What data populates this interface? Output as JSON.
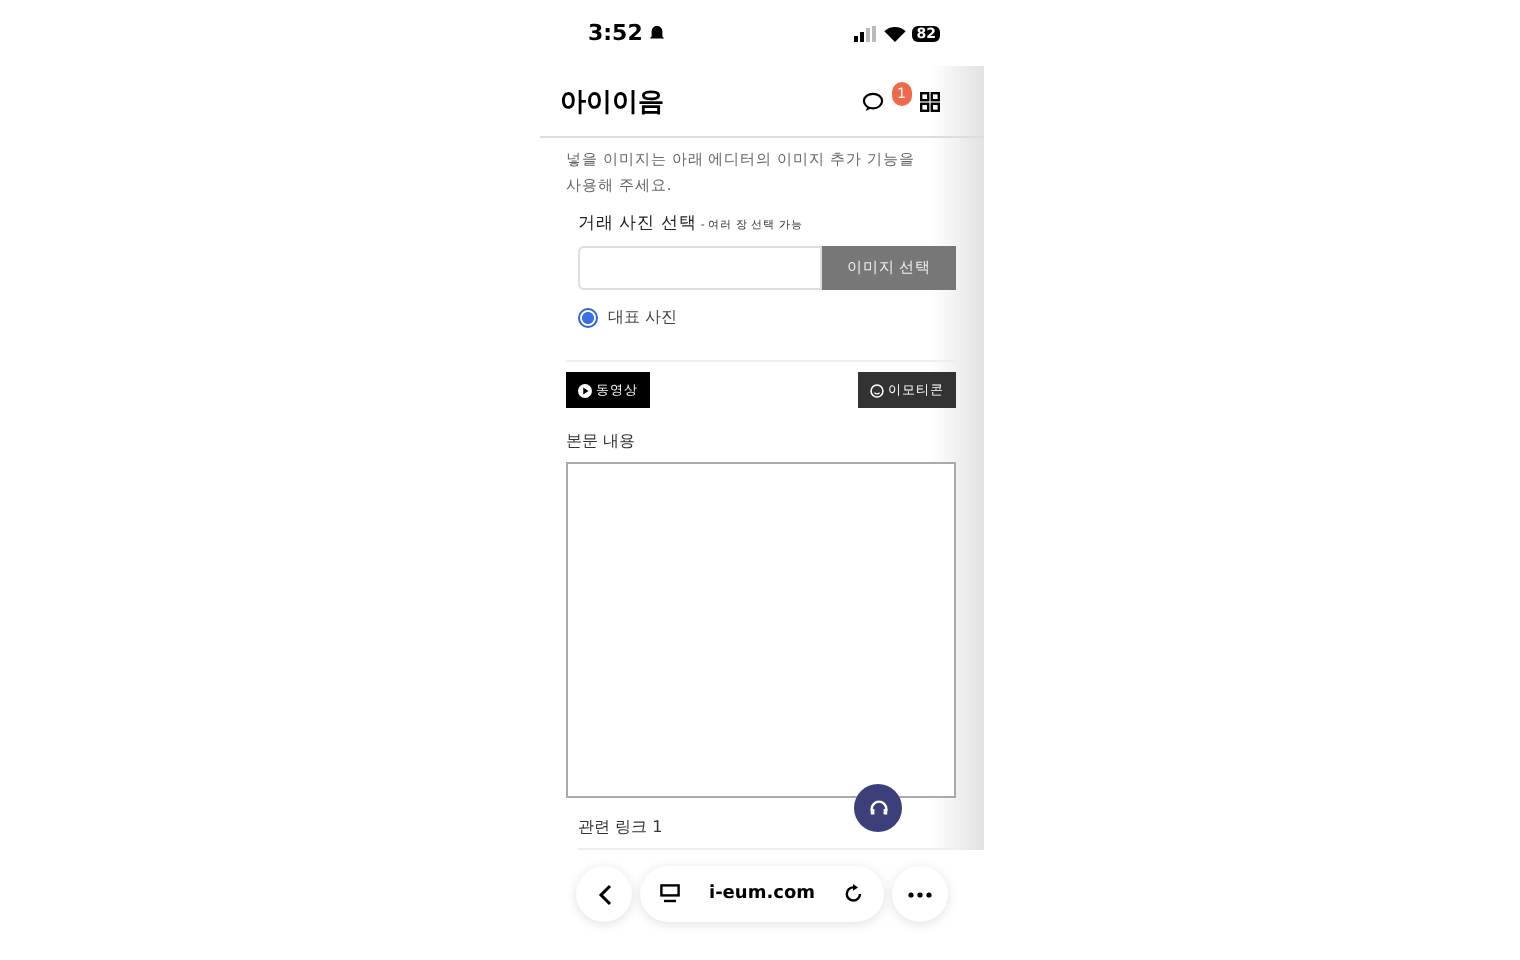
{
  "status_bar": {
    "time": "3:52",
    "battery": "82"
  },
  "header": {
    "title": "아이이음",
    "notification_count": "1"
  },
  "notice": "넣을 이미지는 아래 에디터의 이미지 추가 기능을 사용해 주세요.",
  "photo": {
    "label": "거래 사진 선택",
    "hint": "- 여러 장 선택 가능",
    "button": "이미지 선택",
    "radio": {
      "label": "대표 사진",
      "selected": true
    }
  },
  "toolbar": [
    {
      "label": "동영상",
      "kind": "video"
    },
    {
      "label": "이모티콘",
      "kind": "emoji"
    }
  ],
  "body_label": "본문 내용",
  "link_label": "관련 링크 1",
  "browser": {
    "url": "i-eum.com"
  }
}
